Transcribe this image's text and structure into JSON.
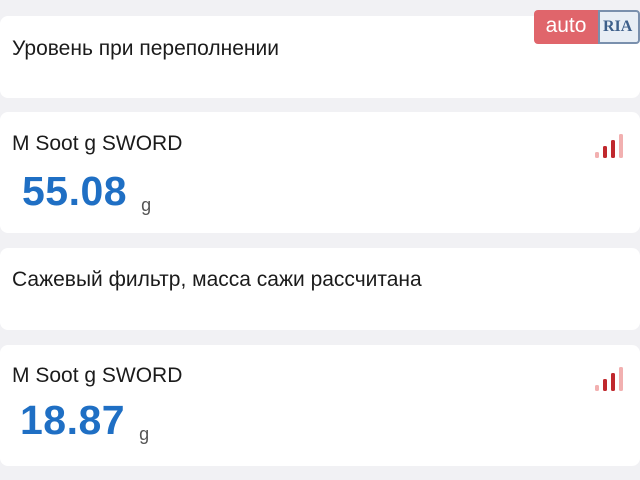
{
  "watermark": {
    "left_text": "auto",
    "right_text": "RIA"
  },
  "cards": [
    {
      "type": "text",
      "label": "Уровень при переполнении"
    },
    {
      "type": "value",
      "title": "M Soot g SWORD",
      "value": "55.08",
      "unit": "g",
      "icon": "signal-bars-icon"
    },
    {
      "type": "text",
      "label": "Сажевый фильтр, масса сажи рассчитана"
    },
    {
      "type": "value",
      "title": "M Soot g SWORD",
      "value": "18.87",
      "unit": "g",
      "icon": "signal-bars-icon"
    }
  ],
  "colors": {
    "value": "#1f6fc4",
    "bar_active": "#c0282d",
    "bar_inactive": "#f2b0b0",
    "background": "#f1f1f4"
  }
}
